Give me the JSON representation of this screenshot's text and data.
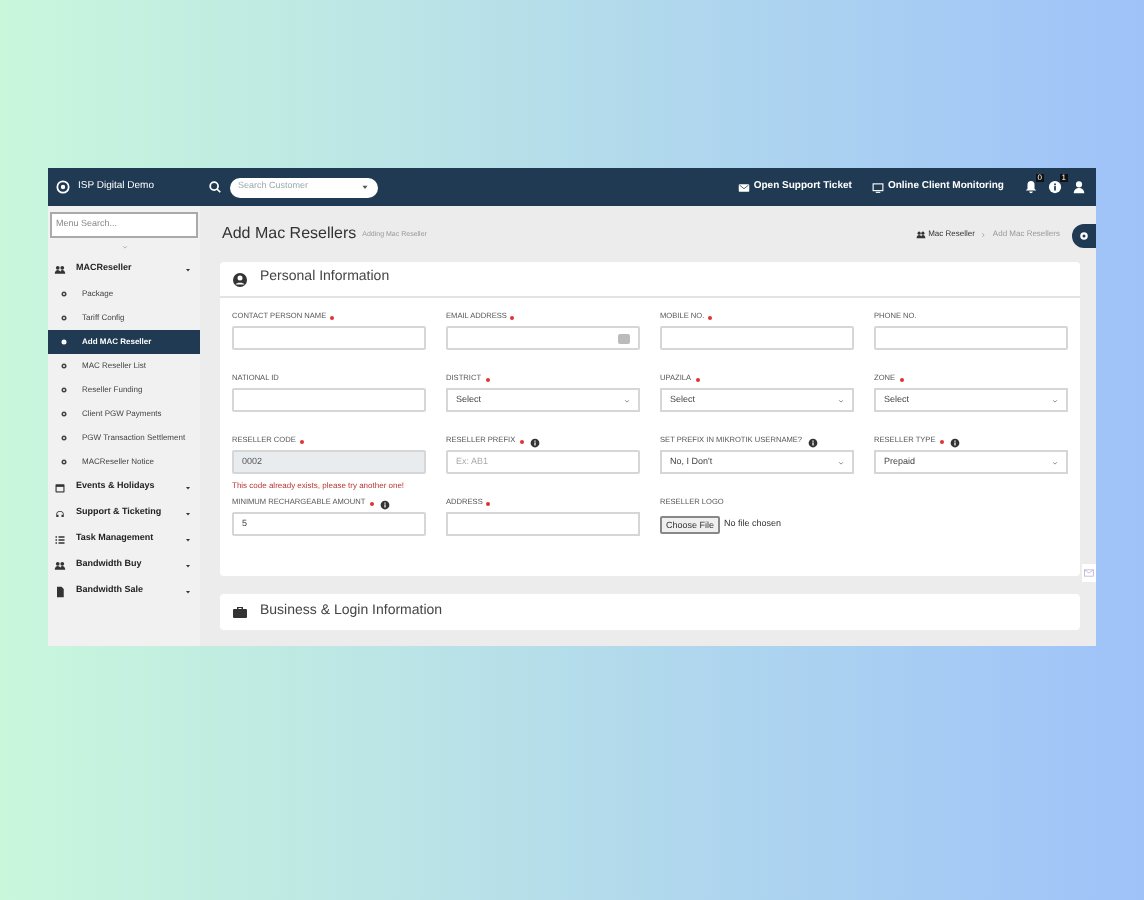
{
  "topbar": {
    "brand": "ISP Digital Demo",
    "search": {
      "placeholder": "Search Customer"
    },
    "links": [
      {
        "kind": "ticket",
        "label": "Open Support Ticket"
      },
      {
        "kind": "monitor",
        "label": "Online Client Monitoring"
      }
    ],
    "badges": [
      {
        "kind": "bell",
        "count": "0"
      },
      {
        "kind": "info",
        "count": "1"
      }
    ]
  },
  "sidebar": {
    "search": {
      "placeholder": "Menu Search..."
    },
    "items": [
      {
        "label": "MACReseller",
        "children": [
          {
            "label": "Package",
            "selected": false
          },
          {
            "label": "Tariff Config",
            "selected": false
          },
          {
            "label": "Add MAC Reseller",
            "selected": true
          },
          {
            "label": "MAC Reseller List",
            "selected": false
          },
          {
            "label": "Reseller Funding",
            "selected": false
          },
          {
            "label": "Client PGW Payments",
            "selected": false
          },
          {
            "label": "PGW Transaction Settlement",
            "selected": false
          },
          {
            "label": "MACReseller Notice",
            "selected": false
          }
        ]
      },
      {
        "label": "Events & Holidays"
      },
      {
        "label": "Support & Ticketing"
      },
      {
        "label": "Task Management"
      },
      {
        "label": "Bandwidth Buy"
      },
      {
        "label": "Bandwidth Sale"
      }
    ]
  },
  "page": {
    "title": "Add Mac Resellers",
    "subtitle": "Adding Mac Reseller",
    "breadcrumb": [
      "Mac Reseller",
      "Add Mac Resellers"
    ]
  },
  "sections": [
    {
      "title": "Personal Information",
      "fields": [
        {
          "kind": "text",
          "label": "CONTACT PERSON NAME",
          "required": true,
          "info": false
        },
        {
          "kind": "text",
          "label": "EMAIL ADDRESS",
          "required": true,
          "info": false,
          "addon": true
        },
        {
          "kind": "text",
          "label": "MOBILE NO.",
          "required": true,
          "info": false
        },
        {
          "kind": "text",
          "label": "PHONE NO.",
          "required": false,
          "info": false
        },
        {
          "kind": "text",
          "label": "NATIONAL ID",
          "required": false,
          "info": false
        },
        {
          "kind": "select",
          "label": "DISTRICT",
          "required": true,
          "info": false,
          "value": "Select"
        },
        {
          "kind": "select",
          "label": "UPAZILA",
          "required": true,
          "info": false,
          "value": "Select"
        },
        {
          "kind": "select",
          "label": "ZONE",
          "required": true,
          "info": false,
          "value": "Select"
        },
        {
          "kind": "text",
          "label": "RESELLER CODE",
          "required": true,
          "info": false,
          "value": "0002",
          "readonly": true,
          "error": "This code already exists, please try another one!"
        },
        {
          "kind": "text",
          "label": "RESELLER PREFIX",
          "required": true,
          "info": true,
          "placeholder": "Ex: AB1"
        },
        {
          "kind": "select",
          "label": "SET PREFIX IN MIKROTIK USERNAME?",
          "required": false,
          "info": true,
          "value": "No, I Don't"
        },
        {
          "kind": "select",
          "label": "RESELLER TYPE",
          "required": true,
          "info": true,
          "value": "Prepaid"
        },
        {
          "kind": "text",
          "label": "MINIMUM RECHARGEABLE AMOUNT",
          "required": true,
          "info": true,
          "value": "5"
        },
        {
          "kind": "textarea",
          "label": "ADDRESS",
          "required": true,
          "info": false
        },
        {
          "kind": "file",
          "label": "RESELLER LOGO",
          "required": false,
          "info": false,
          "button": "Choose File",
          "value": "No file chosen"
        }
      ]
    },
    {
      "title": "Business & Login Information"
    }
  ]
}
